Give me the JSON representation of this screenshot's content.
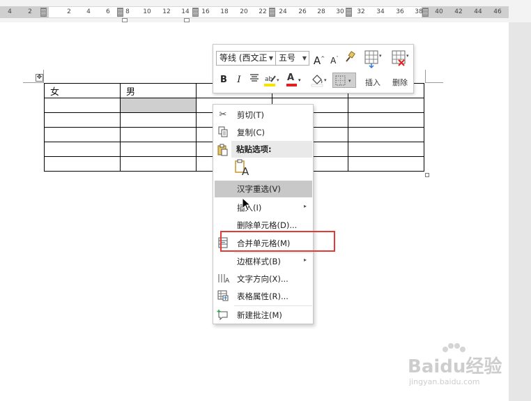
{
  "ruler": {
    "ticks": [
      "4",
      "2",
      "2",
      "4",
      "6",
      "8",
      "10",
      "12",
      "14",
      "16",
      "18",
      "20",
      "22",
      "24",
      "26",
      "28",
      "30",
      "32",
      "34",
      "36",
      "38",
      "40",
      "42",
      "44",
      "46"
    ]
  },
  "table": {
    "rows": [
      [
        "女",
        "男",
        "",
        "",
        ""
      ],
      [
        "",
        "",
        "",
        "",
        ""
      ],
      [
        "",
        "",
        "",
        "",
        ""
      ],
      [
        "",
        "",
        "",
        "",
        ""
      ],
      [
        "",
        "",
        "",
        "",
        ""
      ],
      [
        "",
        "",
        "",
        "",
        ""
      ]
    ],
    "selected_cell": "row 2, column 2"
  },
  "mini_toolbar": {
    "font_name": "等线 (西文正",
    "font_size": "五号",
    "grow_font": "A",
    "shrink_font": "A",
    "bold": "B",
    "italic": "I",
    "font_color_glyph": "A",
    "insert_label": "插入",
    "delete_label": "删除",
    "highlight_color": "#f5e400",
    "font_color": "#e02020"
  },
  "context_menu": {
    "items": [
      {
        "label": "剪切(T)",
        "icon": "scissors-icon"
      },
      {
        "label": "复制(C)",
        "icon": "copy-icon"
      },
      {
        "label": "粘贴选项:",
        "icon": "paste-icon"
      },
      {
        "label": "A",
        "icon": "paste-keep-text-icon"
      },
      {
        "label": "汉字重选(V)",
        "icon": ""
      },
      {
        "label": "插入(I)",
        "icon": "",
        "submenu": "▸"
      },
      {
        "label": "删除单元格(D)...",
        "icon": ""
      },
      {
        "label": "合并单元格(M)",
        "icon": "merge-cells-icon"
      },
      {
        "label": "边框样式(B)",
        "icon": "",
        "submenu": "▸"
      },
      {
        "label": "文字方向(X)...",
        "icon": "text-direction-icon"
      },
      {
        "label": "表格属性(R)...",
        "icon": "table-properties-icon"
      },
      {
        "label": "新建批注(M)",
        "icon": "new-comment-icon"
      }
    ]
  },
  "highlight_box_color": "#e53935",
  "watermark": {
    "brand": "Baidu经验",
    "site": "jingyan.baidu.com"
  }
}
